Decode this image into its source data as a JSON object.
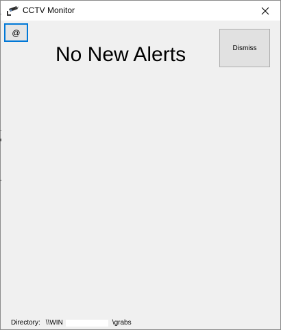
{
  "window": {
    "title": "CCTV Monitor",
    "app_icon": "cctv-camera-icon",
    "close_icon": "close-icon"
  },
  "toolbar": {
    "at_button_label": "@",
    "dismiss_label": "Dismiss"
  },
  "main": {
    "heading": "No New Alerts"
  },
  "status": {
    "directory_label": "Directory:",
    "path_prefix": "\\\\WIN",
    "path_suffix": "\\grabs"
  },
  "colors": {
    "focus_border": "#0078d7",
    "background": "#f0f0f0"
  }
}
